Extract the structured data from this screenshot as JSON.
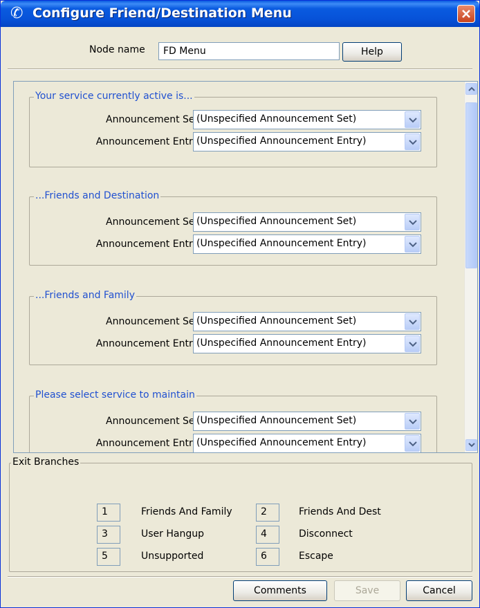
{
  "window": {
    "title": "Configure Friend/Destination Menu"
  },
  "node": {
    "label": "Node name",
    "value": "FD Menu",
    "help_label": "Help"
  },
  "groups": [
    {
      "title": "Your service currently active is...",
      "set_label": "Announcement Set",
      "set_value": "(Unspecified Announcement Set)",
      "entry_label": "Announcement Entry",
      "entry_value": "(Unspecified Announcement Entry)"
    },
    {
      "title": "...Friends and Destination",
      "set_label": "Announcement Set",
      "set_value": "(Unspecified Announcement Set)",
      "entry_label": "Announcement Entry",
      "entry_value": "(Unspecified Announcement Entry)"
    },
    {
      "title": "...Friends and Family",
      "set_label": "Announcement Set",
      "set_value": "(Unspecified Announcement Set)",
      "entry_label": "Announcement Entry",
      "entry_value": "(Unspecified Announcement Entry)"
    },
    {
      "title": "Please select service to maintain",
      "set_label": "Announcement Set",
      "set_value": "(Unspecified Announcement Set)",
      "entry_label": "Announcement Entry",
      "entry_value": "(Unspecified Announcement Entry)"
    }
  ],
  "exit_branches": {
    "title": "Exit Branches",
    "items": [
      {
        "num": "1",
        "name": "Friends And Family"
      },
      {
        "num": "2",
        "name": "Friends And Dest"
      },
      {
        "num": "3",
        "name": "User Hangup"
      },
      {
        "num": "4",
        "name": "Disconnect"
      },
      {
        "num": "5",
        "name": "Unsupported"
      },
      {
        "num": "6",
        "name": "Escape"
      }
    ]
  },
  "buttons": {
    "comments": "Comments",
    "save": "Save",
    "cancel": "Cancel"
  },
  "colors": {
    "titlebar": "#0a5be0",
    "group_title": "#2050d0",
    "background": "#ece9d8"
  }
}
